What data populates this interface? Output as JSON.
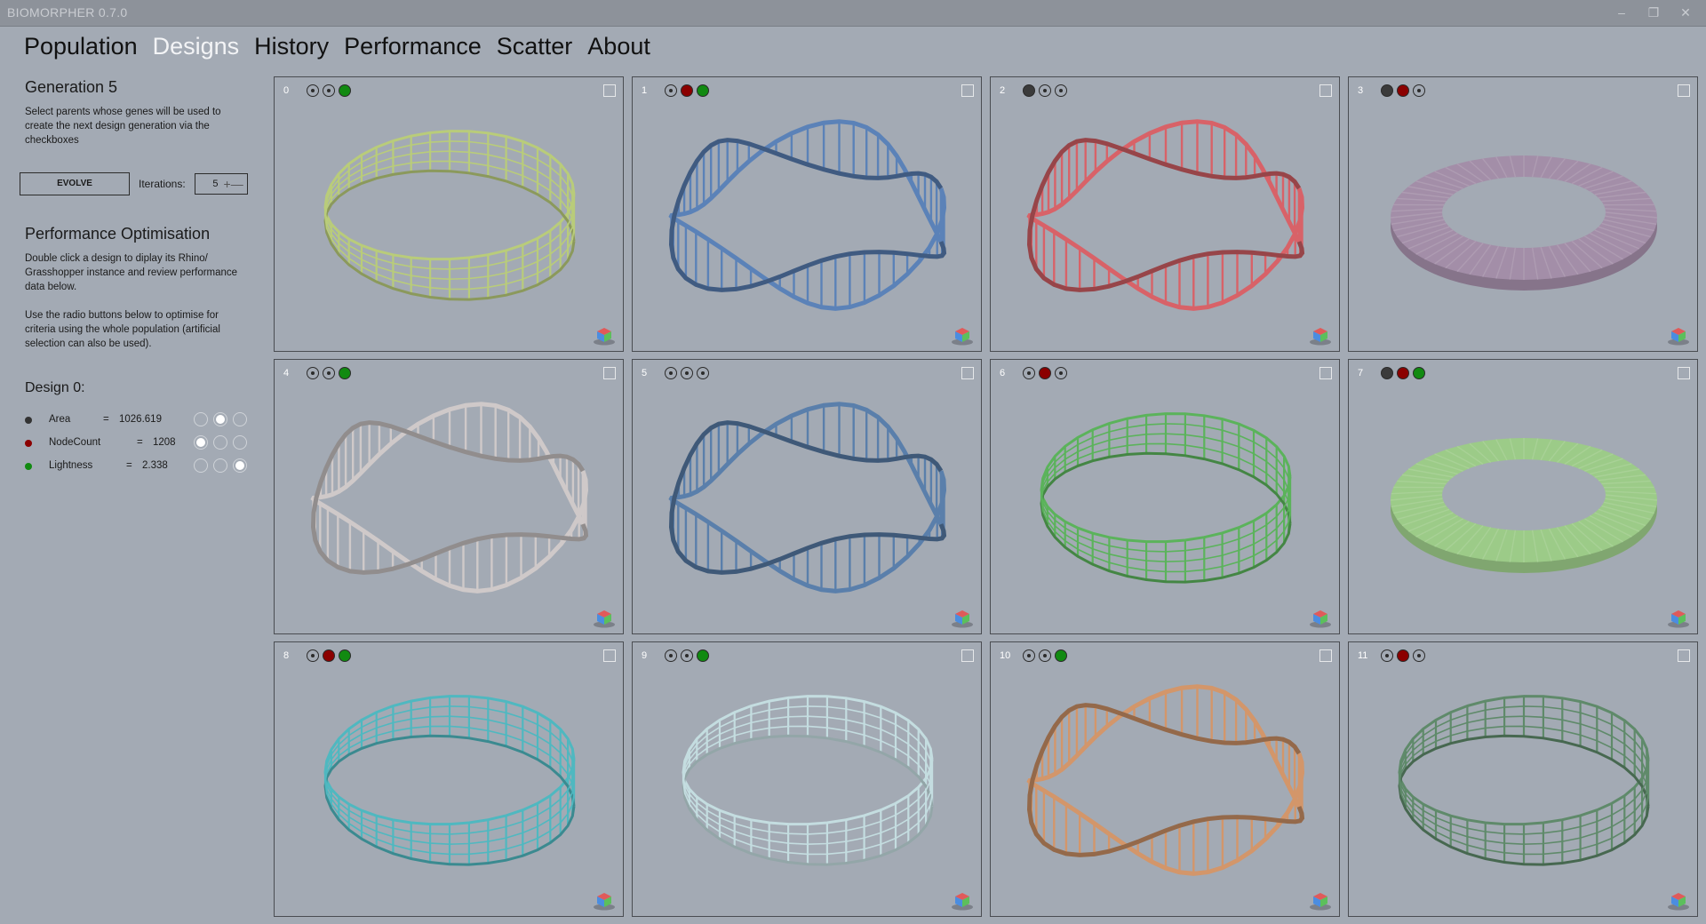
{
  "window": {
    "title": "BIOMORPHER 0.7.0",
    "minimize": "–",
    "maximize": "❐",
    "close": "✕"
  },
  "nav": [
    {
      "label": "Population",
      "active": false
    },
    {
      "label": "Designs",
      "active": true
    },
    {
      "label": "History",
      "active": false
    },
    {
      "label": "Performance",
      "active": false
    },
    {
      "label": "Scatter",
      "active": false
    },
    {
      "label": "About",
      "active": false
    }
  ],
  "sidebar": {
    "generation_title": "Generation 5",
    "generation_desc": "Select parents whose genes will be used to create the next design generation via the checkboxes",
    "evolve_label": "EVOLVE",
    "iterations_label": "Iterations:",
    "iterations_value": "5",
    "perf_title": "Performance Optimisation",
    "perf_desc1": "Double click a design to diplay its Rhino/ Grasshopper instance and review performance data below.",
    "perf_desc2": "Use the radio buttons below to optimise for criteria using the whole population (artificial selection can also be used).",
    "design_title": "Design 0:",
    "metrics": [
      {
        "name": "Area",
        "eq": "=",
        "value": "1026.619",
        "color": "#333333",
        "selected": 1
      },
      {
        "name": "NodeCount",
        "eq": "=",
        "value": "1208",
        "color": "#8b0000",
        "selected": 0
      },
      {
        "name": "Lightness",
        "eq": "=",
        "value": "2.338",
        "color": "#118a11",
        "selected": 2
      }
    ]
  },
  "dot_colors": [
    "#3b3b3b",
    "#8b0000",
    "#118a11"
  ],
  "designs": [
    {
      "index": "0",
      "dots": [
        false,
        false,
        true
      ],
      "color": "#b9cc7a",
      "shape": "mobius"
    },
    {
      "index": "1",
      "dots": [
        false,
        true,
        true
      ],
      "color": "#5b82b8",
      "shape": "twist"
    },
    {
      "index": "2",
      "dots": [
        true,
        false,
        false
      ],
      "color": "#d86268",
      "shape": "twist"
    },
    {
      "index": "3",
      "dots": [
        true,
        true,
        false
      ],
      "color": "#a38ea8",
      "shape": "ring"
    },
    {
      "index": "4",
      "dots": [
        false,
        false,
        true
      ],
      "color": "#cfc9c9",
      "shape": "twist"
    },
    {
      "index": "5",
      "dots": [
        false,
        false,
        false
      ],
      "color": "#5a7fab",
      "shape": "twist"
    },
    {
      "index": "6",
      "dots": [
        false,
        true,
        false
      ],
      "color": "#5bb35b",
      "shape": "mobius"
    },
    {
      "index": "7",
      "dots": [
        true,
        true,
        true
      ],
      "color": "#9ccb88",
      "shape": "ring"
    },
    {
      "index": "8",
      "dots": [
        false,
        true,
        true
      ],
      "color": "#4fb8c0",
      "shape": "mobius"
    },
    {
      "index": "9",
      "dots": [
        false,
        false,
        true
      ],
      "color": "#c4dde0",
      "shape": "mobius"
    },
    {
      "index": "10",
      "dots": [
        false,
        false,
        true
      ],
      "color": "#d3966a",
      "shape": "twist"
    },
    {
      "index": "11",
      "dots": [
        false,
        true,
        false
      ],
      "color": "#5f8a6a",
      "shape": "mobius"
    }
  ]
}
